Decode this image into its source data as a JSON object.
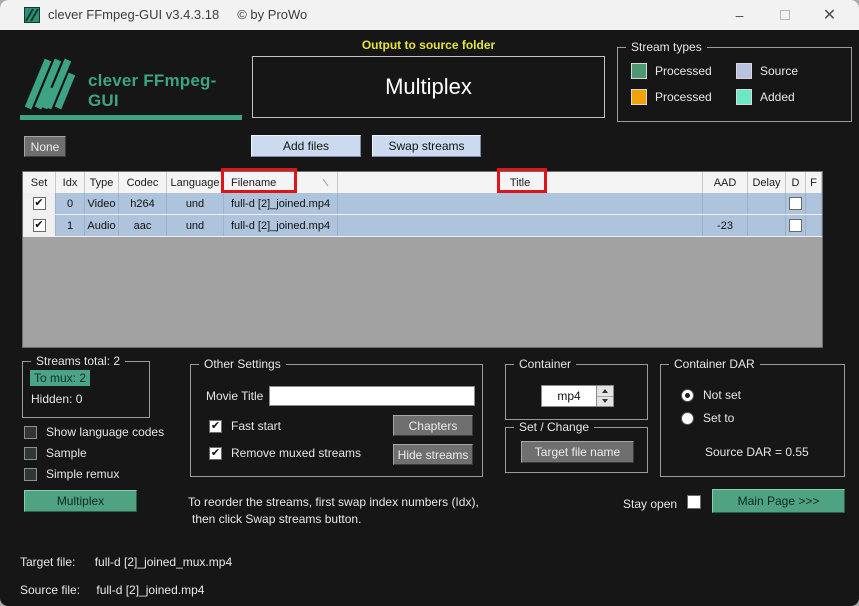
{
  "window": {
    "title": "clever FFmpeg-GUI v3.4.3.18",
    "copyright": "© by ProWo",
    "minimize_glyph": "–",
    "close_glyph": "✕"
  },
  "header": {
    "output_note": "Output to source folder",
    "mode_title": "Multiplex",
    "logo_text": "clever FFmpeg-GUI",
    "accent_color": "#3da385",
    "note_color": "#e4e43a"
  },
  "stream_types": {
    "label": "Stream types",
    "items": [
      {
        "label": "Processed",
        "color": "#4e9771"
      },
      {
        "label": "Source",
        "color": "#b9c3e0"
      },
      {
        "label": "Processed",
        "color": "#f0a20c"
      },
      {
        "label": "Added",
        "color": "#69e9c6"
      }
    ]
  },
  "toolbar": {
    "none_label": "None",
    "add_files_label": "Add files",
    "swap_streams_label": "Swap streams"
  },
  "table": {
    "columns": [
      "Set",
      "Idx",
      "Type",
      "Codec",
      "Language",
      "Filename",
      "Title",
      "AAD",
      "Delay",
      "D",
      "F"
    ],
    "row_color": "#aec4dd",
    "annotation_color": "#df1418",
    "rows": [
      {
        "set": true,
        "idx": "0",
        "type": "Video",
        "codec": "h264",
        "language": "und",
        "filename": "full-d [2]_joined.mp4",
        "title": "",
        "aad": "",
        "delay": "",
        "d": false,
        "f": ""
      },
      {
        "set": true,
        "idx": "1",
        "type": "Audio",
        "codec": "aac",
        "language": "und",
        "filename": "full-d [2]_joined.mp4",
        "title": "",
        "aad": "-23",
        "delay": "",
        "d": false,
        "f": ""
      }
    ]
  },
  "streams_summary": {
    "label": "Streams total:  2",
    "to_mux": "To mux:  2",
    "hidden": "Hidden:  0",
    "highlight_color": "#4ba389"
  },
  "options": {
    "show_language_codes": {
      "label": "Show language codes",
      "checked": false
    },
    "sample": {
      "label": "Sample",
      "checked": false
    },
    "simple_remux": {
      "label": "Simple remux",
      "checked": false
    }
  },
  "multiplex_button_label": "Multiplex",
  "other_settings": {
    "label": "Other Settings",
    "movie_title_label": "Movie Title",
    "movie_title_value": "",
    "fast_start": {
      "label": "Fast start",
      "checked": true
    },
    "remove_muxed": {
      "label": "Remove muxed streams",
      "checked": true
    },
    "chapters_label": "Chapters",
    "hide_streams_label": "Hide streams"
  },
  "container": {
    "label": "Container",
    "value": "mp4"
  },
  "set_change": {
    "label": "Set / Change",
    "target_file_name_label": "Target file name"
  },
  "container_dar": {
    "label": "Container DAR",
    "not_set": {
      "label": "Not set",
      "checked": true
    },
    "set_to": {
      "label": "Set to",
      "checked": false
    },
    "source_dar": "Source DAR = 0.55"
  },
  "footer": {
    "instruction_line1": "To reorder the streams, first swap index numbers (Idx),",
    "instruction_line2": "then click Swap streams button.",
    "stay_open": {
      "label": "Stay open",
      "checked": false
    },
    "main_page_label": "Main Page >>>",
    "target_file_label": "Target file:",
    "target_file_value": "full-d [2]_joined_mux.mp4",
    "source_file_label": "Source file:",
    "source_file_value": "full-d [2]_joined.mp4"
  }
}
